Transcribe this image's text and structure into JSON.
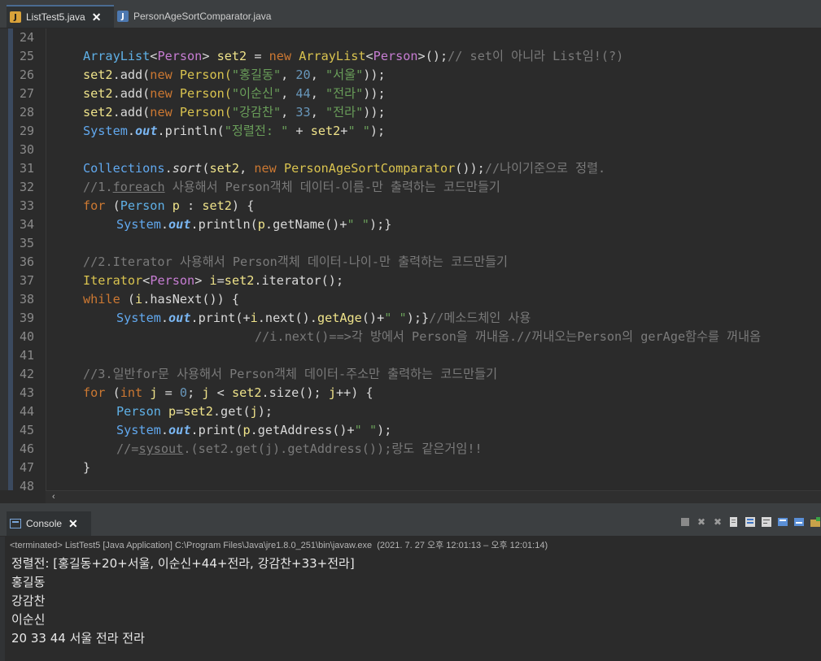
{
  "editor_tabs": [
    {
      "label": "ListTest5.java",
      "active": true
    },
    {
      "label": "PersonAgeSortComparator.java",
      "active": false
    }
  ],
  "line_numbers": [
    "24",
    "25",
    "26",
    "27",
    "28",
    "29",
    "30",
    "31",
    "32",
    "33",
    "34",
    "35",
    "36",
    "37",
    "38",
    "39",
    "40",
    "41",
    "42",
    "43",
    "44",
    "45",
    "46",
    "47",
    "48"
  ],
  "code": {
    "l25": {
      "a": "ArrayList",
      "b": "<",
      "c": "Person",
      "d": "> ",
      "e": "set2",
      "f": " = ",
      "g": "new ",
      "h": "ArrayList",
      "i": "<",
      "j": "Person",
      "k": ">();",
      "m": "// set이 아니라 List임!(?)"
    },
    "l26": {
      "a": "set2",
      "b": ".add(",
      "c": "new ",
      "d": "Person(",
      "e": "\"홍길동\"",
      "f": ", ",
      "g": "20",
      "h": ", ",
      "i": "\"서울\"",
      "j": "));"
    },
    "l27": {
      "a": "set2",
      "b": ".add(",
      "c": "new ",
      "d": "Person(",
      "e": "\"이순신\"",
      "f": ", ",
      "g": "44",
      "h": ", ",
      "i": "\"전라\"",
      "j": "));"
    },
    "l28": {
      "a": "set2",
      "b": ".add(",
      "c": "new ",
      "d": "Person(",
      "e": "\"강감찬\"",
      "f": ", ",
      "g": "33",
      "h": ", ",
      "i": "\"전라\"",
      "j": "));"
    },
    "l29": {
      "a": "System",
      "b": ".",
      "c": "out",
      "d": ".println(",
      "e": "\"정렬전: \"",
      "f": " + ",
      "g": "set2",
      "h": "+",
      "i": "\" \"",
      "j": ");"
    },
    "l31": {
      "a": "Collections",
      "b": ".",
      "c": "sort",
      "d": "(",
      "e": "set2",
      "f": ", ",
      "g": "new ",
      "h": "PersonAgeSortComparator",
      "i": "());",
      "j": "//나이기준으로 정렬."
    },
    "l32": {
      "a": "//1.",
      "b": "foreach",
      "c": " 사용해서 Person객체 데이터-이름-만 출력하는 코드만들기"
    },
    "l33": {
      "a": "for ",
      "b": "(",
      "c": "Person ",
      "d": "p",
      "e": " : ",
      "f": "set2",
      "g": ") {"
    },
    "l34": {
      "a": "System",
      "b": ".",
      "c": "out",
      "d": ".println(",
      "e": "p",
      "f": ".getName()+",
      "g": "\" \"",
      "h": ");}"
    },
    "l36": {
      "a": "//2.Iterator 사용해서 Person객체 데이터-나이-만 출력하는 코드만들기"
    },
    "l37": {
      "a": "Iterator",
      "b": "<",
      "c": "Person",
      "d": "> ",
      "e": "i",
      "f": "=",
      "g": "set2",
      "h": ".iterator();"
    },
    "l38": {
      "a": "while ",
      "b": "(",
      "c": "i",
      "d": ".hasNext()) {"
    },
    "l39": {
      "a": "System",
      "b": ".",
      "c": "out",
      "d": ".print(+",
      "e": "i",
      "f": ".next().",
      "g": "getAge",
      "h": "()+",
      "i": "\" \"",
      "j": ");}",
      "k": "//메소드체인 사용"
    },
    "l40": {
      "a": "//i.next()==>각 방에서 Person을 꺼내옴.//꺼내오는Person의 gerAge함수를 꺼내옴"
    },
    "l42": {
      "a": "//3.일반for문 사용해서 Person객체 데이터-주소만 출력하는 코드만들기"
    },
    "l43": {
      "a": "for ",
      "b": "(",
      "c": "int ",
      "d": "j",
      "e": " = ",
      "f": "0",
      "g": "; ",
      "h": "j",
      "i": " < ",
      "j": "set2",
      "k": ".size(); ",
      "m": "j",
      "n": "++) {"
    },
    "l44": {
      "a": "Person ",
      "b": "p",
      "c": "=",
      "d": "set2",
      "e": ".get(",
      "f": "j",
      "g": ");"
    },
    "l45": {
      "a": "System",
      "b": ".",
      "c": "out",
      "d": ".print(",
      "e": "p",
      "f": ".getAddress()+",
      "g": "\" \"",
      "h": ");"
    },
    "l46": {
      "a": "//=",
      "b": "sysout",
      "c": ".(set2.get(j).getAddress());랑도 같은거임!!"
    },
    "l47": {
      "a": "}"
    }
  },
  "console": {
    "tab_label": "Console",
    "terminated": "<terminated> ListTest5 [Java Application] C:\\Program Files\\Java\\jre1.8.0_251\\bin\\javaw.exe  (2021. 7. 27 오후 12:01:13 – 오후 12:01:14)",
    "output": [
      "정렬전: [홍길동+20+서울, 이순신+44+전라, 강감찬+33+전라]",
      "홍길동",
      "강감찬",
      "이순신",
      "20 33 44 서울 전라 전라"
    ]
  },
  "colors": {
    "editor_bg": "#2b2b2b",
    "keyword": "#cc7832",
    "type": "#5fb0e6",
    "string": "#6a9f5a",
    "number": "#6897bb",
    "comment": "#7a7a7a"
  }
}
